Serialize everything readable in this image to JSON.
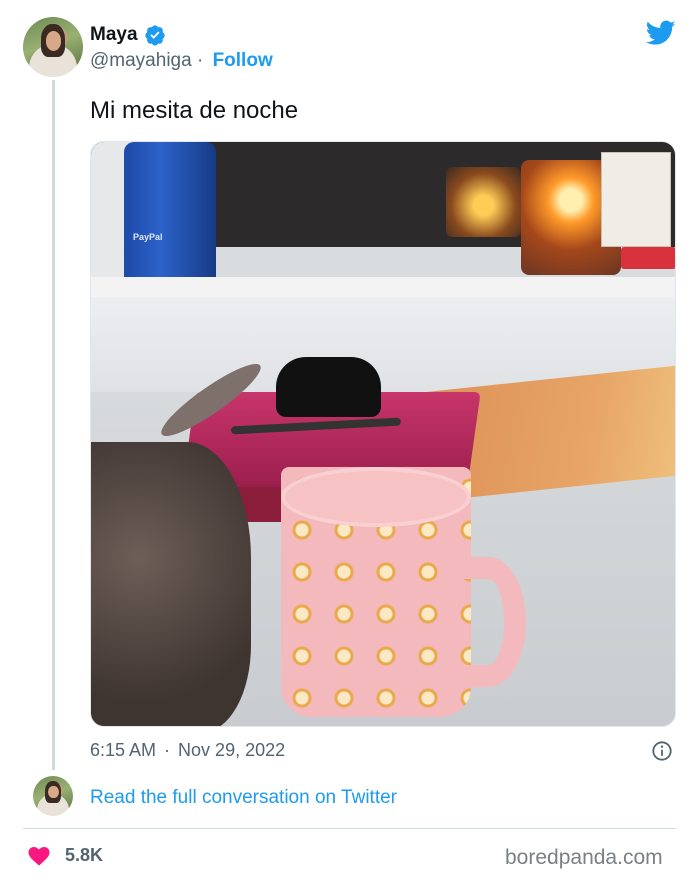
{
  "tweet": {
    "author": {
      "display_name": "Maya",
      "handle": "@mayahiga",
      "verified": true
    },
    "separator": "·",
    "follow_label": "Follow",
    "text": "Mi mesita de noche",
    "photo_label": "PayPal",
    "time": "6:15 AM",
    "date": "Nov 29, 2022",
    "read_conversation_label": "Read the full conversation on Twitter",
    "likes": "5.8K"
  },
  "watermark": "boredpanda.com",
  "icons": {
    "brand": "twitter-bird-icon",
    "verified": "verified-badge-icon",
    "info": "info-icon",
    "like": "heart-icon"
  },
  "colors": {
    "accent": "#1d9bf0",
    "text_primary": "#0f1419",
    "text_secondary": "#536471",
    "like": "#f91880",
    "divider": "#cfd9de"
  }
}
